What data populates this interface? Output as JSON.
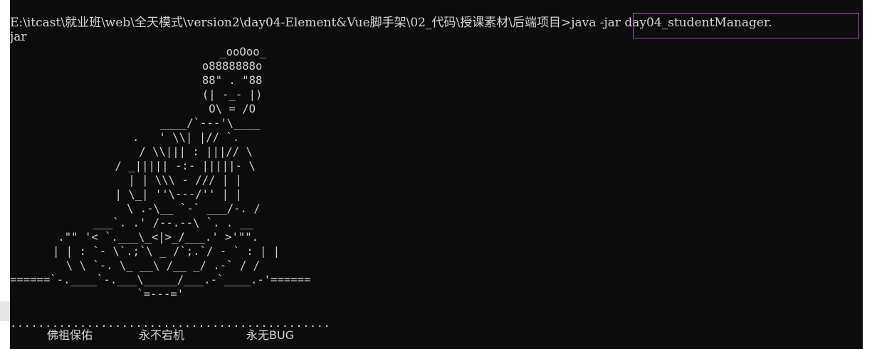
{
  "terminal": {
    "prompt_path": "E:\\itcast\\就业班\\web\\全天模式\\version2\\day04-Element&Vue脚手架\\02_代码\\授课素材\\后端项目",
    "command": ">java -jar day04_studentManager.",
    "command_wrap": "jar",
    "banner_lines": [
      "           _ooOoo_",
      "          o8888888o",
      "          88\" . \"88",
      "          (| -_- |)",
      "           O\\ = /O",
      "       ____/`---'\\____",
      "     .   ' \\\\| |// `.",
      "      / \\\\||| : |||// \\",
      "    / _||||| -:- |||||- \\",
      "      | | \\\\\\ - /// | |",
      "    | \\_| ''\\---/'' | |",
      "     \\ .-\\__ `-` ___/-. /",
      "   ___`. .' /--.--\\ `. . __",
      " .\"\" '< `.___\\_<|>_/___.' >'\"\".",
      "| | : `- \\`.;`\\ _ /`;.`/ - ` : | |",
      "  \\ \\ `-. \\_ __\\ /__ _/ .-` / /",
      "======`-.____`-.___\\_____/___.-`____.-'======",
      "                   `=---='"
    ],
    "dots": "..............................................",
    "blessings": [
      "佛祖保佑",
      "永不宕机",
      "永无BUG"
    ]
  }
}
